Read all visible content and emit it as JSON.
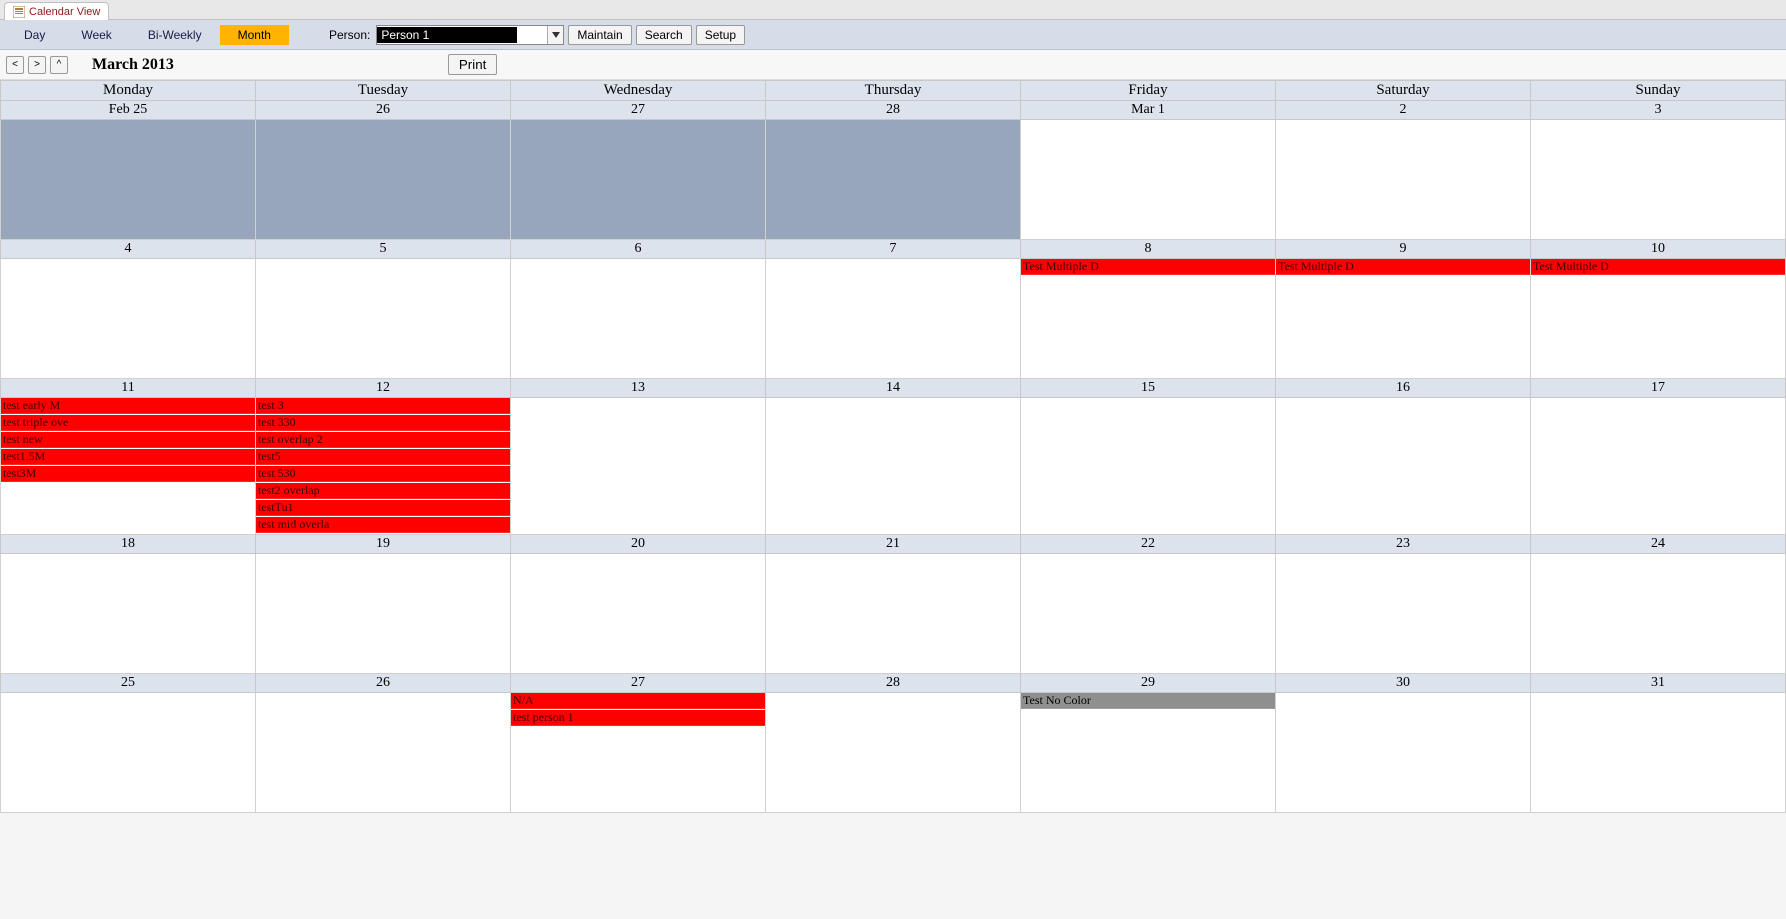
{
  "tab": {
    "title": "Calendar View"
  },
  "toolbar": {
    "views": [
      "Day",
      "Week",
      "Bi-Weekly",
      "Month"
    ],
    "active_view": "Month",
    "person_label": "Person:",
    "person_value": "Person 1",
    "maintain": "Maintain",
    "search": "Search",
    "setup": "Setup"
  },
  "nav": {
    "month_title": "March 2013",
    "print": "Print"
  },
  "daynames": [
    "Monday",
    "Tuesday",
    "Wednesday",
    "Thursday",
    "Friday",
    "Saturday",
    "Sunday"
  ],
  "weeks": [
    {
      "dates": [
        "Feb 25",
        "26",
        "27",
        "28",
        "Mar 1",
        "2",
        "3"
      ],
      "cells": [
        {
          "dim": true,
          "events": []
        },
        {
          "dim": true,
          "events": []
        },
        {
          "dim": true,
          "events": []
        },
        {
          "dim": true,
          "events": []
        },
        {
          "dim": false,
          "events": []
        },
        {
          "dim": false,
          "events": []
        },
        {
          "dim": false,
          "events": []
        }
      ]
    },
    {
      "dates": [
        "4",
        "5",
        "6",
        "7",
        "8",
        "9",
        "10"
      ],
      "cells": [
        {
          "dim": false,
          "events": []
        },
        {
          "dim": false,
          "events": []
        },
        {
          "dim": false,
          "events": []
        },
        {
          "dim": false,
          "events": []
        },
        {
          "dim": false,
          "events": [
            {
              "label": "Test Multiple D",
              "color": "red"
            }
          ]
        },
        {
          "dim": false,
          "events": [
            {
              "label": "Test Multiple D",
              "color": "red"
            }
          ]
        },
        {
          "dim": false,
          "events": [
            {
              "label": "Test Multiple D",
              "color": "red"
            }
          ]
        }
      ]
    },
    {
      "dates": [
        "11",
        "12",
        "13",
        "14",
        "15",
        "16",
        "17"
      ],
      "cells": [
        {
          "dim": false,
          "events": [
            {
              "label": "test early M",
              "color": "red"
            },
            {
              "label": "test triple ove",
              "color": "red"
            },
            {
              "label": "test new",
              "color": "red"
            },
            {
              "label": "test1.5M",
              "color": "red"
            },
            {
              "label": "test3M",
              "color": "red"
            }
          ]
        },
        {
          "dim": false,
          "events": [
            {
              "label": "test 3",
              "color": "red"
            },
            {
              "label": "test 330",
              "color": "red"
            },
            {
              "label": "test overlap 2",
              "color": "red"
            },
            {
              "label": "test5",
              "color": "red"
            },
            {
              "label": "test 530",
              "color": "red"
            },
            {
              "label": "test2 overlap",
              "color": "red"
            },
            {
              "label": "testTu1",
              "color": "red"
            },
            {
              "label": "test mid overla",
              "color": "red"
            }
          ]
        },
        {
          "dim": false,
          "events": []
        },
        {
          "dim": false,
          "events": []
        },
        {
          "dim": false,
          "events": []
        },
        {
          "dim": false,
          "events": []
        },
        {
          "dim": false,
          "events": []
        }
      ]
    },
    {
      "dates": [
        "18",
        "19",
        "20",
        "21",
        "22",
        "23",
        "24"
      ],
      "cells": [
        {
          "dim": false,
          "events": []
        },
        {
          "dim": false,
          "events": []
        },
        {
          "dim": false,
          "events": []
        },
        {
          "dim": false,
          "events": []
        },
        {
          "dim": false,
          "events": []
        },
        {
          "dim": false,
          "events": []
        },
        {
          "dim": false,
          "events": []
        }
      ]
    },
    {
      "dates": [
        "25",
        "26",
        "27",
        "28",
        "29",
        "30",
        "31"
      ],
      "cells": [
        {
          "dim": false,
          "events": []
        },
        {
          "dim": false,
          "events": []
        },
        {
          "dim": false,
          "events": [
            {
              "label": "N/A",
              "color": "red"
            },
            {
              "label": "test person 1",
              "color": "red"
            }
          ]
        },
        {
          "dim": false,
          "events": []
        },
        {
          "dim": false,
          "events": [
            {
              "label": "Test No Color",
              "color": "gray"
            }
          ]
        },
        {
          "dim": false,
          "events": []
        },
        {
          "dim": false,
          "events": []
        }
      ]
    }
  ]
}
